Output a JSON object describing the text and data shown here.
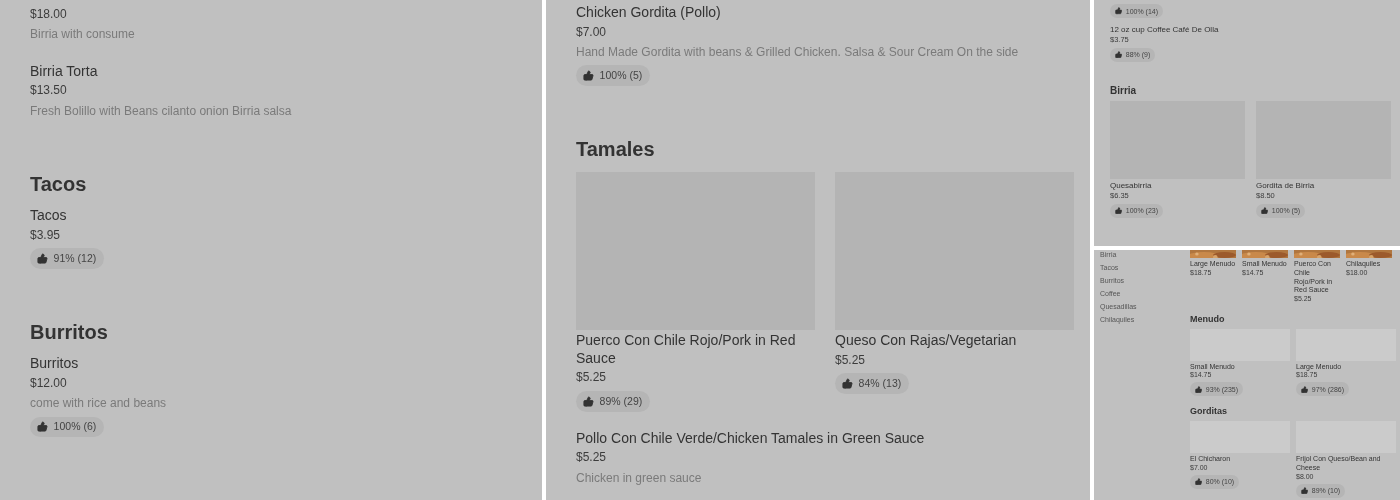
{
  "panels": [
    {
      "kind": "large",
      "blocks": [
        {
          "kind": "item",
          "price": "$18.00",
          "description": "Birria with consume"
        },
        {
          "kind": "item",
          "name": "Birria Torta",
          "price": "$13.50",
          "description": "Fresh Bolillo with Beans cilanto onion Birria salsa"
        },
        {
          "kind": "heading",
          "text": "Tacos"
        },
        {
          "kind": "item",
          "name": "Tacos",
          "price": "$3.95",
          "rating": "91% (12)"
        },
        {
          "kind": "heading",
          "text": "Burritos"
        },
        {
          "kind": "item",
          "name": "Burritos",
          "price": "$12.00",
          "description": "come with rice and beans",
          "rating": "100% (6)"
        }
      ]
    },
    {
      "kind": "large",
      "blocks": [
        {
          "kind": "item",
          "name": "Chicken Gordita (Pollo)",
          "price": "$7.00",
          "description": "Hand Made Gordita with beans & Grilled Chicken. Salsa & Sour Cream On the side",
          "rating": "100% (5)"
        },
        {
          "kind": "heading",
          "text": "Tamales"
        },
        {
          "kind": "grid",
          "items": [
            {
              "kind": "placeholder",
              "name": "Puerco Con Chile Rojo/Pork in Red Sauce",
              "price": "$5.25",
              "rating": "89% (29)"
            },
            {
              "kind": "placeholder",
              "name": "Queso Con Rajas/Vegetarian",
              "price": "$5.25",
              "rating": "84% (13)"
            }
          ]
        },
        {
          "kind": "item",
          "name": "Pollo Con Chile Verde/Chicken Tamales in Green Sauce",
          "price": "$5.25",
          "description": "Chicken in green sauce"
        }
      ]
    },
    {
      "kind": "small",
      "blocks": [
        {
          "kind": "item",
          "rating": "100% (14)"
        },
        {
          "kind": "item",
          "name": "12 oz cup Coffee Café De Olla",
          "price": "$3.75",
          "rating": "88% (9)"
        },
        {
          "kind": "heading",
          "text": "Birria"
        },
        {
          "kind": "grid",
          "items": [
            {
              "kind": "placeholder",
              "name": "Quesabirria",
              "price": "$6.35",
              "rating": "100% (23)"
            },
            {
              "kind": "placeholder",
              "name": "Gordita de Birria",
              "price": "$8.50",
              "rating": "100% (5)"
            }
          ]
        }
      ]
    },
    {
      "kind": "tiny",
      "sidebar": [
        "Birria",
        "Tacos",
        "Burritos",
        "Coffee",
        "Quesadillas",
        "Chilaquiles"
      ],
      "blocks": [
        {
          "kind": "grid",
          "items": [
            {
              "kind": "picture",
              "name": "Large Menudo",
              "price": "$18.75"
            },
            {
              "kind": "picture",
              "name": "Small Menudo",
              "price": "$14.75"
            },
            {
              "kind": "picture",
              "name": "Puerco Con Chile Rojo/Pork in Red Sauce",
              "price": "$5.25"
            },
            {
              "kind": "picture",
              "name": "Chilaquiles",
              "price": "$18.00"
            }
          ]
        },
        {
          "kind": "heading",
          "text": "Menudo"
        },
        {
          "kind": "grid",
          "items": [
            {
              "kind": "placeholder",
              "name": "Small Menudo",
              "price": "$14.75",
              "rating": "93% (235)"
            },
            {
              "kind": "placeholder",
              "name": "Large Menudo",
              "price": "$18.75",
              "rating": "97% (286)"
            }
          ]
        },
        {
          "kind": "heading",
          "text": "Gorditas"
        },
        {
          "kind": "grid",
          "items": [
            {
              "kind": "placeholder",
              "name": "El Chicharon",
              "price": "$7.00",
              "rating": "80% (10)"
            },
            {
              "kind": "placeholder",
              "name": "Frijol Con Queso/Bean and Cheese",
              "price": "$8.00",
              "rating": "89% (10)"
            }
          ]
        }
      ]
    }
  ]
}
